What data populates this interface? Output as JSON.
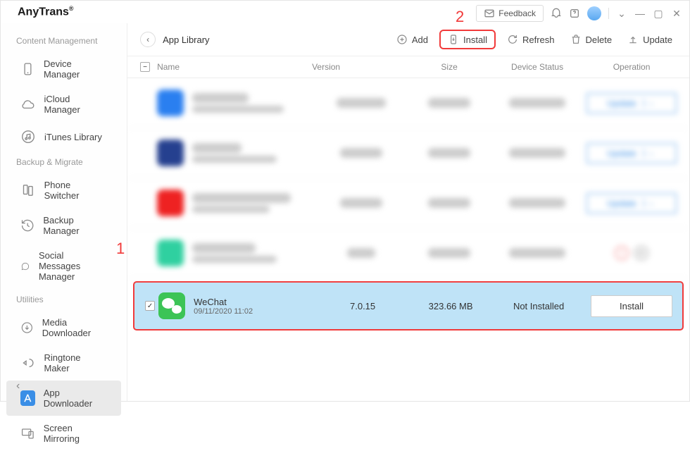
{
  "brand": "AnyTrans",
  "titlebar": {
    "feedback": "Feedback"
  },
  "sidebar": {
    "sections": [
      {
        "label": "Content Management",
        "items": [
          {
            "label": "Device Manager"
          },
          {
            "label": "iCloud Manager"
          },
          {
            "label": "iTunes Library"
          }
        ]
      },
      {
        "label": "Backup & Migrate",
        "items": [
          {
            "label": "Phone Switcher"
          },
          {
            "label": "Backup Manager"
          },
          {
            "label": "Social Messages Manager"
          }
        ]
      },
      {
        "label": "Utilities",
        "items": [
          {
            "label": "Media Downloader"
          },
          {
            "label": "Ringtone Maker"
          },
          {
            "label": "App Downloader"
          },
          {
            "label": "Screen Mirroring"
          }
        ]
      }
    ]
  },
  "toolbar": {
    "crumb": "App Library",
    "add": "Add",
    "install": "Install",
    "refresh": "Refresh",
    "delete": "Delete",
    "update": "Update"
  },
  "table": {
    "headers": {
      "name": "Name",
      "version": "Version",
      "size": "Size",
      "status": "Device Status",
      "op": "Operation"
    },
    "update_label": "Update",
    "install_label": "Install",
    "selected": {
      "name": "WeChat",
      "date": "09/11/2020 11:02",
      "version": "7.0.15",
      "size": "323.66 MB",
      "status": "Not Installed"
    }
  },
  "callouts": {
    "one": "1",
    "two": "2"
  }
}
